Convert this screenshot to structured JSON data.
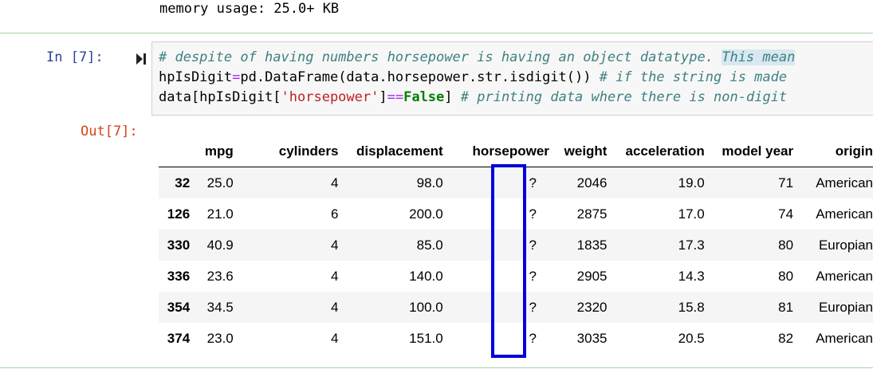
{
  "previous_output": {
    "memory_line": "memory usage: 25.0+ KB"
  },
  "input_cell": {
    "prompt": "In [7]:",
    "code": {
      "line1_comment": "# despite of having numbers horsepower is having an object datatype. ",
      "line1_highlight": "This mean",
      "line2_code_a": "hpIsDigit",
      "line2_op": "=",
      "line2_code_b": "pd.DataFrame(data.horsepower.str.isdigit()) ",
      "line2_comment": "# if the string is made",
      "line3_code_a": "data[hpIsDigit[",
      "line3_str": "'horsepower'",
      "line3_code_b": "]",
      "line3_op": "==",
      "line3_kw": "False",
      "line3_code_c": "] ",
      "line3_comment": "# printing data where there is non-digit"
    }
  },
  "output_cell": {
    "prompt": "Out[7]:",
    "table": {
      "columns": [
        "",
        "mpg",
        "cylinders",
        "displacement",
        "horsepower",
        "weight",
        "acceleration",
        "model year",
        "origin"
      ],
      "rows": [
        {
          "index": "32",
          "mpg": "25.0",
          "cylinders": "4",
          "displacement": "98.0",
          "horsepower": "?",
          "weight": "2046",
          "acceleration": "19.0",
          "model_year": "71",
          "origin": "American"
        },
        {
          "index": "126",
          "mpg": "21.0",
          "cylinders": "6",
          "displacement": "200.0",
          "horsepower": "?",
          "weight": "2875",
          "acceleration": "17.0",
          "model_year": "74",
          "origin": "American"
        },
        {
          "index": "330",
          "mpg": "40.9",
          "cylinders": "4",
          "displacement": "85.0",
          "horsepower": "?",
          "weight": "1835",
          "acceleration": "17.3",
          "model_year": "80",
          "origin": "Europian"
        },
        {
          "index": "336",
          "mpg": "23.6",
          "cylinders": "4",
          "displacement": "140.0",
          "horsepower": "?",
          "weight": "2905",
          "acceleration": "14.3",
          "model_year": "80",
          "origin": "American"
        },
        {
          "index": "354",
          "mpg": "34.5",
          "cylinders": "4",
          "displacement": "100.0",
          "horsepower": "?",
          "weight": "2320",
          "acceleration": "15.8",
          "model_year": "81",
          "origin": "Europian"
        },
        {
          "index": "374",
          "mpg": "23.0",
          "cylinders": "4",
          "displacement": "151.0",
          "horsepower": "?",
          "weight": "3035",
          "acceleration": "20.5",
          "model_year": "82",
          "origin": "American"
        }
      ]
    },
    "highlight_color": "#0000dd"
  },
  "colors": {
    "in_prompt": "#303f9f",
    "out_prompt": "#d84315",
    "comment": "#408080",
    "cell_border": "#a6d5a6"
  }
}
